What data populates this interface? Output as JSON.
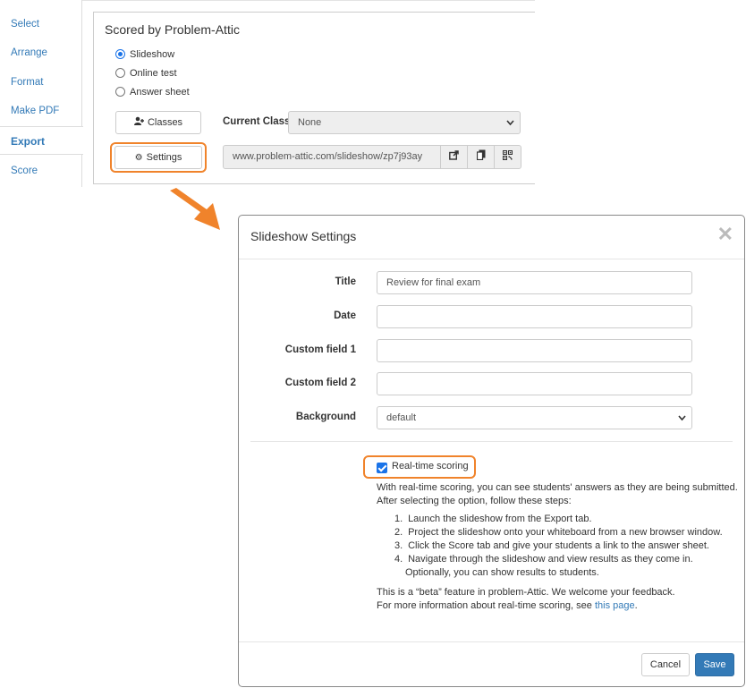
{
  "nav": {
    "items": [
      {
        "label": "Select"
      },
      {
        "label": "Arrange"
      },
      {
        "label": "Format"
      },
      {
        "label": "Make PDF"
      },
      {
        "label": "Export"
      },
      {
        "label": "Score"
      }
    ],
    "active": "Export"
  },
  "panel": {
    "title": "Scored by Problem-Attic",
    "options": [
      {
        "label": "Slideshow",
        "checked": true
      },
      {
        "label": "Online test",
        "checked": false
      },
      {
        "label": "Answer sheet",
        "checked": false
      }
    ],
    "classes_button": "Classes",
    "settings_button": "Settings",
    "current_class_label": "Current Class:",
    "current_class_value": "None",
    "url": "www.problem-attic.com/slideshow/zp7j93ay"
  },
  "modal": {
    "title": "Slideshow Settings",
    "fields": [
      {
        "label": "Title",
        "value": "Review for final exam"
      },
      {
        "label": "Date",
        "value": ""
      },
      {
        "label": "Custom field 1",
        "value": ""
      },
      {
        "label": "Custom field 2",
        "value": ""
      }
    ],
    "background_label": "Background",
    "background_value": "default",
    "realtime_label": "Real-time scoring",
    "realtime_checked": true,
    "intro_1": "With real-time scoring, you can see students' answers as they are being submitted.",
    "intro_2": "After selecting the option, follow these steps:",
    "steps": [
      {
        "num": "1.",
        "text": "Launch the slideshow from the Export tab."
      },
      {
        "num": "2.",
        "text": "Project the slideshow onto your whiteboard from a new browser window."
      },
      {
        "num": "3.",
        "text": "Click the Score tab and give your students a link to the answer sheet."
      },
      {
        "num": "4.",
        "text": "Navigate through the slideshow and view results as they come in."
      }
    ],
    "step_4_cont": "Optionally, you can show results to students.",
    "beta_note": "This is a “beta” feature in problem-Attic. We welcome your feedback.",
    "more_info": "For more information about real-time scoring, see",
    "link_text": "this page",
    "link_suffix": ".",
    "cancel_button": "Cancel",
    "save_button": "Save"
  },
  "colors": {
    "highlight": "#f0832b",
    "link": "#337ab7",
    "primary": "#337ab7"
  }
}
